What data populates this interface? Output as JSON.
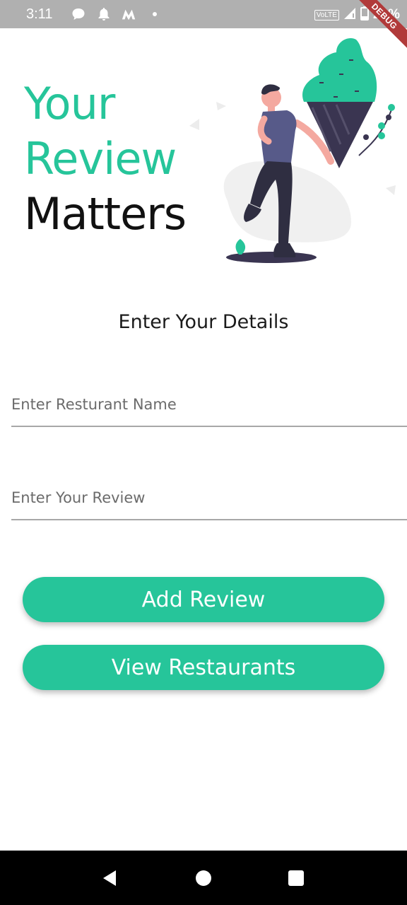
{
  "status_bar": {
    "time": "3:11",
    "volte": "VoLTE",
    "battery": "20%",
    "left_icons": [
      "chat-bubble-icon",
      "bell-icon",
      "m-logo-icon",
      "dot-icon"
    ],
    "right_icons": [
      "volte-icon",
      "signal-icon",
      "battery-icon"
    ]
  },
  "debug_banner": "DEBUG",
  "header": {
    "line1": "Your",
    "line2": "Review",
    "line3": "Matters"
  },
  "illustration": "person-with-ice-cream-illustration",
  "form": {
    "heading": "Enter Your Details",
    "restaurant_placeholder": "Enter Resturant Name",
    "review_placeholder": "Enter Your Review"
  },
  "buttons": {
    "add_review": "Add Review",
    "view_restaurants": "View Restaurants"
  },
  "nav": [
    "back-icon",
    "home-icon",
    "recent-apps-icon"
  ],
  "colors": {
    "accent": "#26c59a",
    "status_bar": "#b0b0b0",
    "nav_bar": "#000000",
    "debug": "#b13a3a"
  }
}
